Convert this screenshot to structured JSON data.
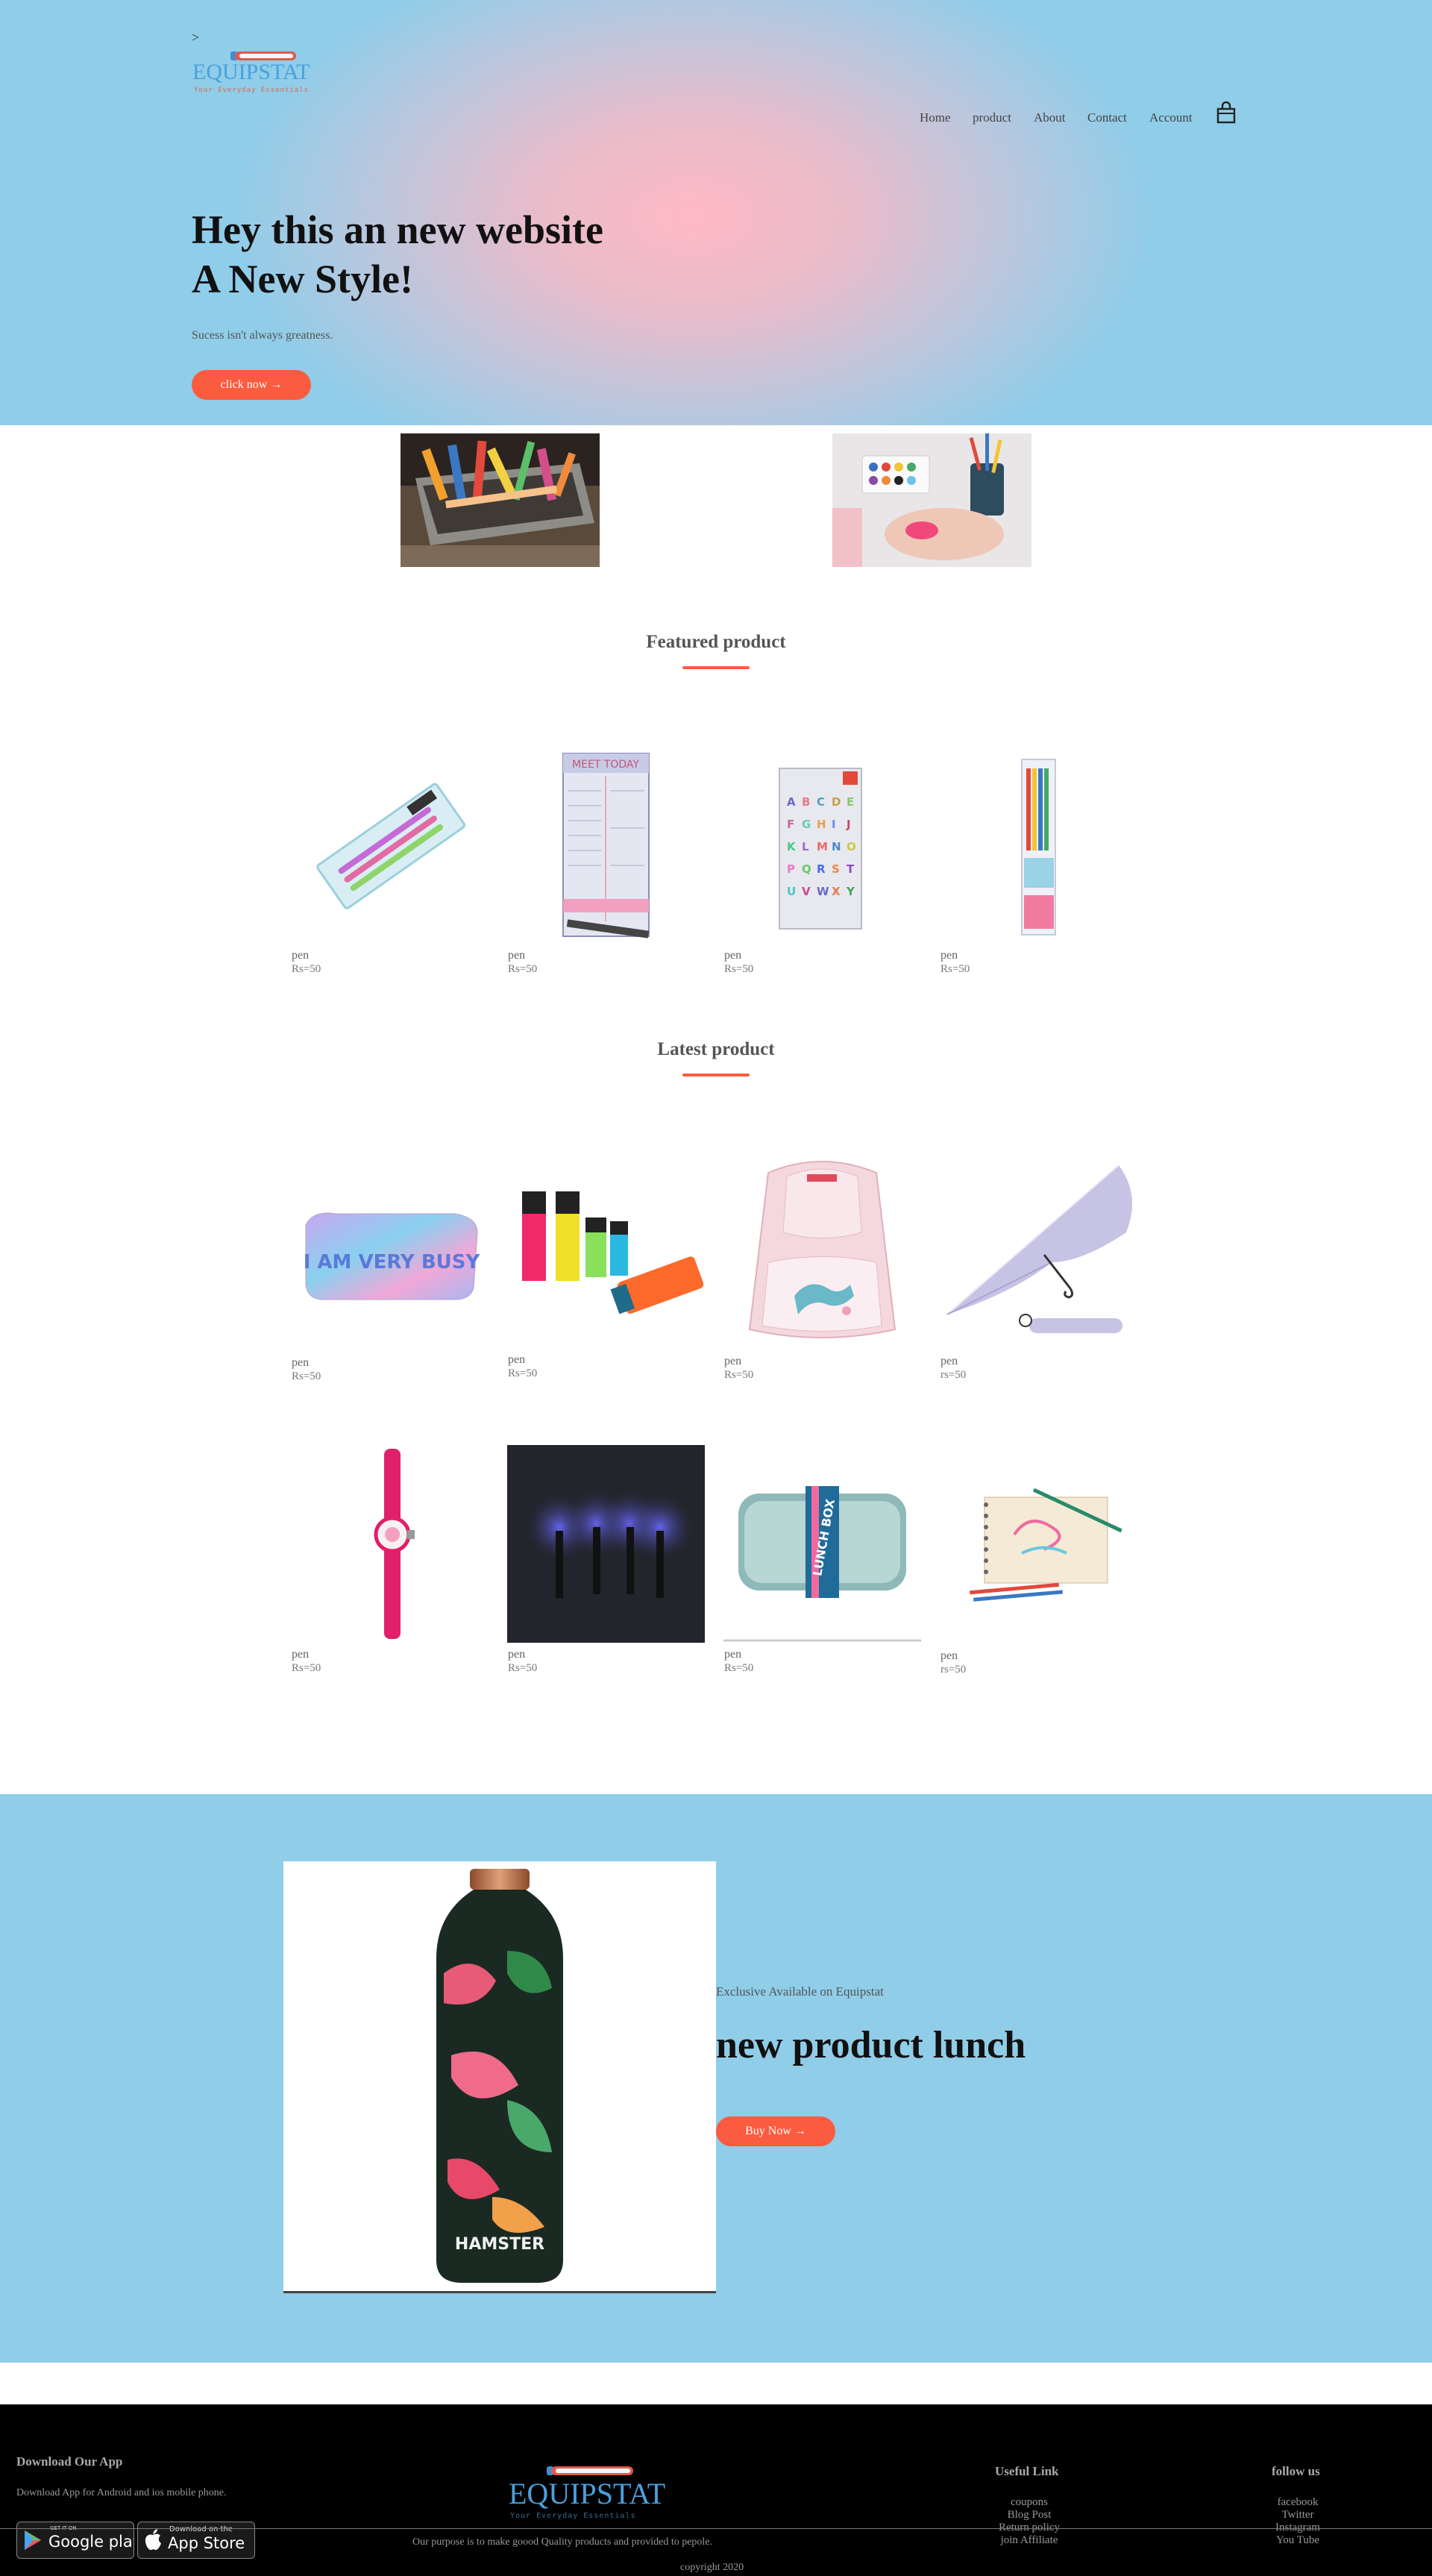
{
  "header": {
    "caret": ">",
    "logo_text": "EQUIPSTAT",
    "logo_tagline": "Your Everyday Essentials",
    "nav": [
      "Home",
      "product",
      "About",
      "Contact",
      "Account"
    ],
    "cart_icon": "shopping-bag-icon"
  },
  "hero": {
    "title_line1": "Hey this an new website",
    "title_line2": "A New Style!",
    "subtitle": "Sucess isn't always greatness.",
    "button": "click now →"
  },
  "featured": {
    "title": "Featured product",
    "products": [
      {
        "name": "pen",
        "price": "Rs=50"
      },
      {
        "name": "pen",
        "price": "Rs=50"
      },
      {
        "name": "pen",
        "price": "Rs=50"
      },
      {
        "name": "pen",
        "price": "Rs=50"
      }
    ]
  },
  "latest": {
    "title": "Latest product",
    "products": [
      {
        "name": "pen",
        "price": "Rs=50"
      },
      {
        "name": "pen",
        "price": "Rs=50"
      },
      {
        "name": "pen",
        "price": "Rs=50"
      },
      {
        "name": "pen",
        "price": "rs=50"
      },
      {
        "name": "pen",
        "price": "Rs=50"
      },
      {
        "name": "pen",
        "price": "Rs=50"
      },
      {
        "name": "pen",
        "price": "Rs=50"
      },
      {
        "name": "pen",
        "price": "rs=50"
      }
    ],
    "pouch_text": "I AM VERY BUSY",
    "umbrella_text": "HAMSTER",
    "lunchbox_text": "LUNCH BOX"
  },
  "promo": {
    "small": "Exclusive Available on Equipstat",
    "title": "new product lunch",
    "button": "Buy Now →",
    "bottle_text": "HAMSTER"
  },
  "footer": {
    "download_title": "Download Our App",
    "download_text": "Download App for Android and ios mobile phone.",
    "google_small": "GET IT ON",
    "google_big": "Google play",
    "apple_small": "Download on the",
    "apple_big": "App Store",
    "logo_text": "EQUIPSTAT",
    "logo_tagline": "Your Everyday Essentials",
    "purpose": "Our purpose is to make goood Quality products and provided to pepole.",
    "useful_title": "Useful Link",
    "useful_links": [
      "coupons",
      "Blog Post",
      "Return policy",
      "join Affiliate"
    ],
    "follow_title": "follow us",
    "follow_links": [
      "facebook",
      "Twitter",
      "Instagram",
      "You Tube"
    ],
    "copyright": "copyright 2020"
  },
  "colors": {
    "accent": "#fb5b3f",
    "logo_blue": "#4aa0dd",
    "hero_sky": "#8fcde9",
    "hero_pink": "#ffb9c4"
  }
}
